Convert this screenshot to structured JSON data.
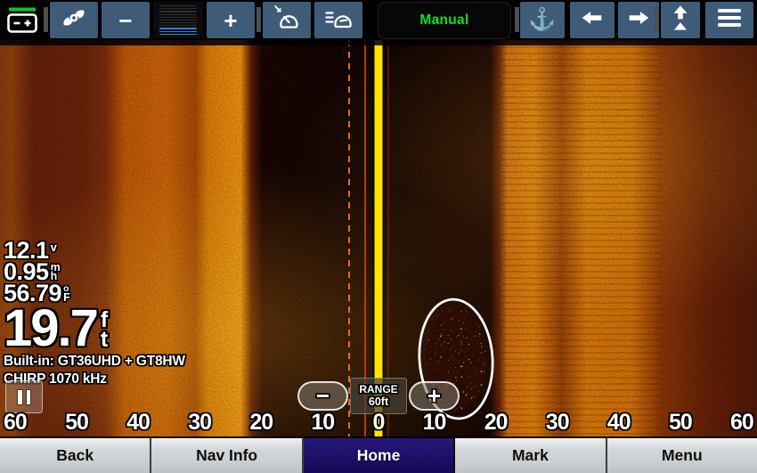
{
  "topbar": {
    "mode_label": "Manual",
    "minus_label": "−",
    "plus_label": "+",
    "anchor_glyph": "⚓",
    "icon_names": [
      "battery-status",
      "sonar-gain-swoosh",
      "gain-minus",
      "gain-level-meter",
      "gain-plus",
      "zoom-gauge-arrow",
      "scroll-speed-gauge",
      "anchor",
      "arrow-left",
      "arrow-right",
      "double-up-arrow",
      "hamburger-menu"
    ]
  },
  "data_overlay": {
    "voltage": "12.1",
    "voltage_unit": "v",
    "speed": "0.95",
    "speed_unit_num": "m",
    "speed_unit_den": "h",
    "temperature": "56.79",
    "temperature_unit_deg": "o",
    "temperature_unit_scale": "F",
    "depth": "19.7",
    "depth_unit_top": "f",
    "depth_unit_bottom": "t",
    "transducer": "Built-in: GT36UHD + GT8HW",
    "frequency": "CHIRP 1070 kHz"
  },
  "range_control": {
    "label": "RANGE",
    "value": "60ft",
    "minus_label": "−",
    "plus_label": "+"
  },
  "scale_labels": [
    "60",
    "50",
    "40",
    "30",
    "20",
    "10",
    "0",
    "10",
    "20",
    "30",
    "40",
    "50",
    "60"
  ],
  "navbar": {
    "items": [
      {
        "label": "Back",
        "active": false
      },
      {
        "label": "Nav Info",
        "active": false
      },
      {
        "label": "Home",
        "active": true
      },
      {
        "label": "Mark",
        "active": false
      },
      {
        "label": "Menu",
        "active": false
      }
    ]
  },
  "colors": {
    "toolbar_button_blue": "#3e5b78",
    "manual_green": "#15df27",
    "battery_green": "#00cc22",
    "gain_meter_blue": "#2e7fd6",
    "active_nav_navy": "#1c1068",
    "center_line_yellow": "#ffe400",
    "annotation_white": "#ffffff"
  }
}
